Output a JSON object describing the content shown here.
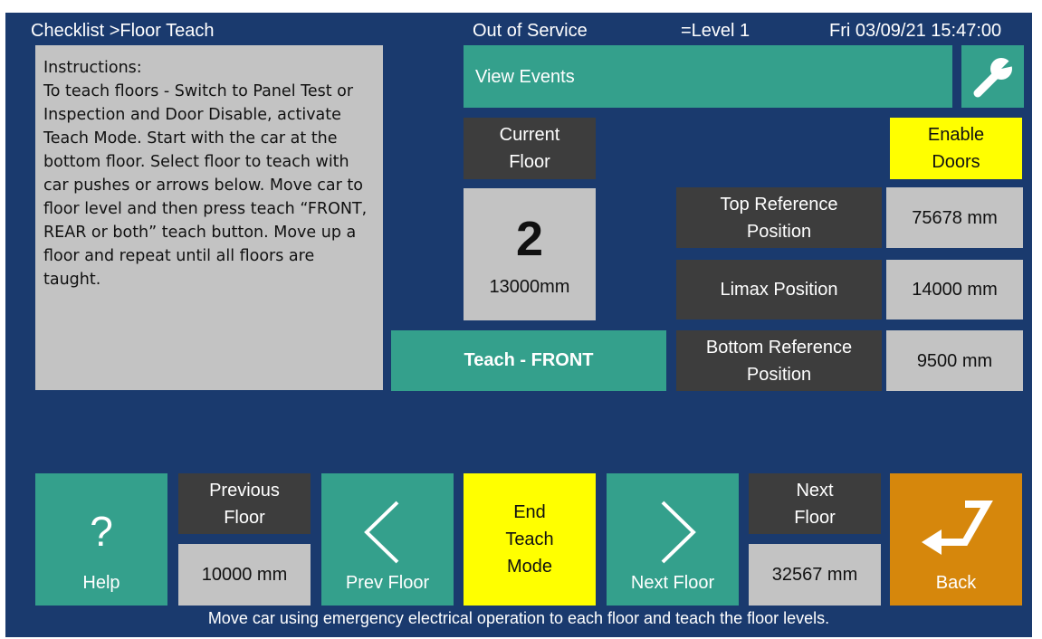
{
  "header": {
    "breadcrumb": "Checklist >Floor Teach",
    "status": "Out of Service",
    "level": "=Level 1",
    "datetime": "Fri 03/09/21 15:47:00"
  },
  "instructions": {
    "title": "Instructions:",
    "body": "To teach floors - Switch to Panel Test or Inspection and Door Disable, activate Teach Mode. Start with the car at the bottom floor. Select floor to teach with car pushes or arrows below. Move car to floor level and then press teach “FRONT, REAR or both” teach button. Move up a floor and repeat until all floors are taught."
  },
  "events": {
    "label": "View Events",
    "tools_icon": "wrench-icon"
  },
  "current_floor": {
    "label_line1": "Current",
    "label_line2": "Floor",
    "number": "2",
    "position": "13000mm"
  },
  "enable_doors": {
    "line1": "Enable",
    "line2": "Doors"
  },
  "positions": {
    "top_ref": {
      "line1": "Top Reference",
      "line2": "Position",
      "value": "75678 mm"
    },
    "limax": {
      "label": "Limax Position",
      "value": "14000 mm"
    },
    "bottom_ref": {
      "line1": "Bottom Reference",
      "line2": "Position",
      "value": "9500 mm"
    }
  },
  "teach_button": "Teach - FRONT",
  "bottom_bar": {
    "help": {
      "glyph": "?",
      "label": "Help"
    },
    "previous_floor": {
      "line1": "Previous",
      "line2": "Floor",
      "value": "10000 mm"
    },
    "prev_button": "Prev Floor",
    "end_teach": {
      "line1": "End",
      "line2": "Teach",
      "line3": "Mode"
    },
    "next_button": "Next Floor",
    "next_floor": {
      "line1": "Next",
      "line2": "Floor",
      "value": "32567 mm"
    },
    "back": {
      "label": "Back"
    }
  },
  "footer": "Move car using emergency electrical operation to each floor and teach the floor levels.",
  "colors": {
    "background": "#1a3a6e",
    "teal": "#34a08c",
    "dark": "#3d3d3d",
    "grey": "#c3c3c3",
    "yellow": "#ffff00",
    "orange": "#d6870c"
  }
}
